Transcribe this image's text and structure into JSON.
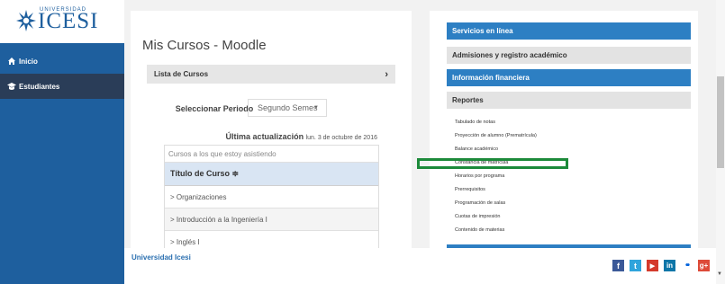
{
  "logo": {
    "small_text": "UNIVERSIDAD",
    "name": "ICESI"
  },
  "sidebar": {
    "items": [
      {
        "label": "Inicio",
        "icon": "home-icon"
      },
      {
        "label": "Estudiantes",
        "icon": "students-icon"
      }
    ]
  },
  "main": {
    "title": "Mis Cursos - Moodle",
    "lista_label": "Lista de Cursos",
    "periodo_label": "Seleccionar Periodo",
    "periodo_value": "Segundo Semes",
    "ultima_label": "Última actualización",
    "ultima_date": "lun. 3 de octubre de 2016",
    "table": {
      "caption": "Cursos a los que estoy asistiendo",
      "header": "Título de Curso ≑",
      "rows": [
        "> Organizaciones",
        "> Introducción a la Ingeniería I",
        "> Inglés I"
      ]
    }
  },
  "right": {
    "servicios": "Servicios en línea",
    "admisiones": "Admisiones y registro académico",
    "financiera": "Información financiera",
    "reportes": "Reportes",
    "items": [
      "Tabulado de notas",
      "Proyección de alumno (Prematrícula)",
      "Balance académico",
      "Constancia de matrícula",
      "Horarios por programa",
      "Prerrequisitos",
      "Programación de salas",
      "Cuotas de impresión",
      "Contenido de materias"
    ]
  },
  "footer": {
    "text": "Universidad Icesi"
  },
  "social": [
    {
      "icon": "facebook-icon",
      "glyph": "f",
      "color": "#3b5998"
    },
    {
      "icon": "twitter-icon",
      "glyph": "t",
      "color": "#2fa4dc"
    },
    {
      "icon": "youtube-icon",
      "glyph": "▶",
      "color": "#d43a2c"
    },
    {
      "icon": "linkedin-icon",
      "glyph": "in",
      "color": "#0e76a8"
    },
    {
      "icon": "flickr-icon",
      "glyph": "••",
      "color": "#ffffff"
    },
    {
      "icon": "googleplus-icon",
      "glyph": "g+",
      "color": "#dd4b39"
    }
  ],
  "colors": {
    "brand": "#1e5f9e",
    "accent": "#2d7fc3",
    "highlight": "#1c8a3a"
  }
}
